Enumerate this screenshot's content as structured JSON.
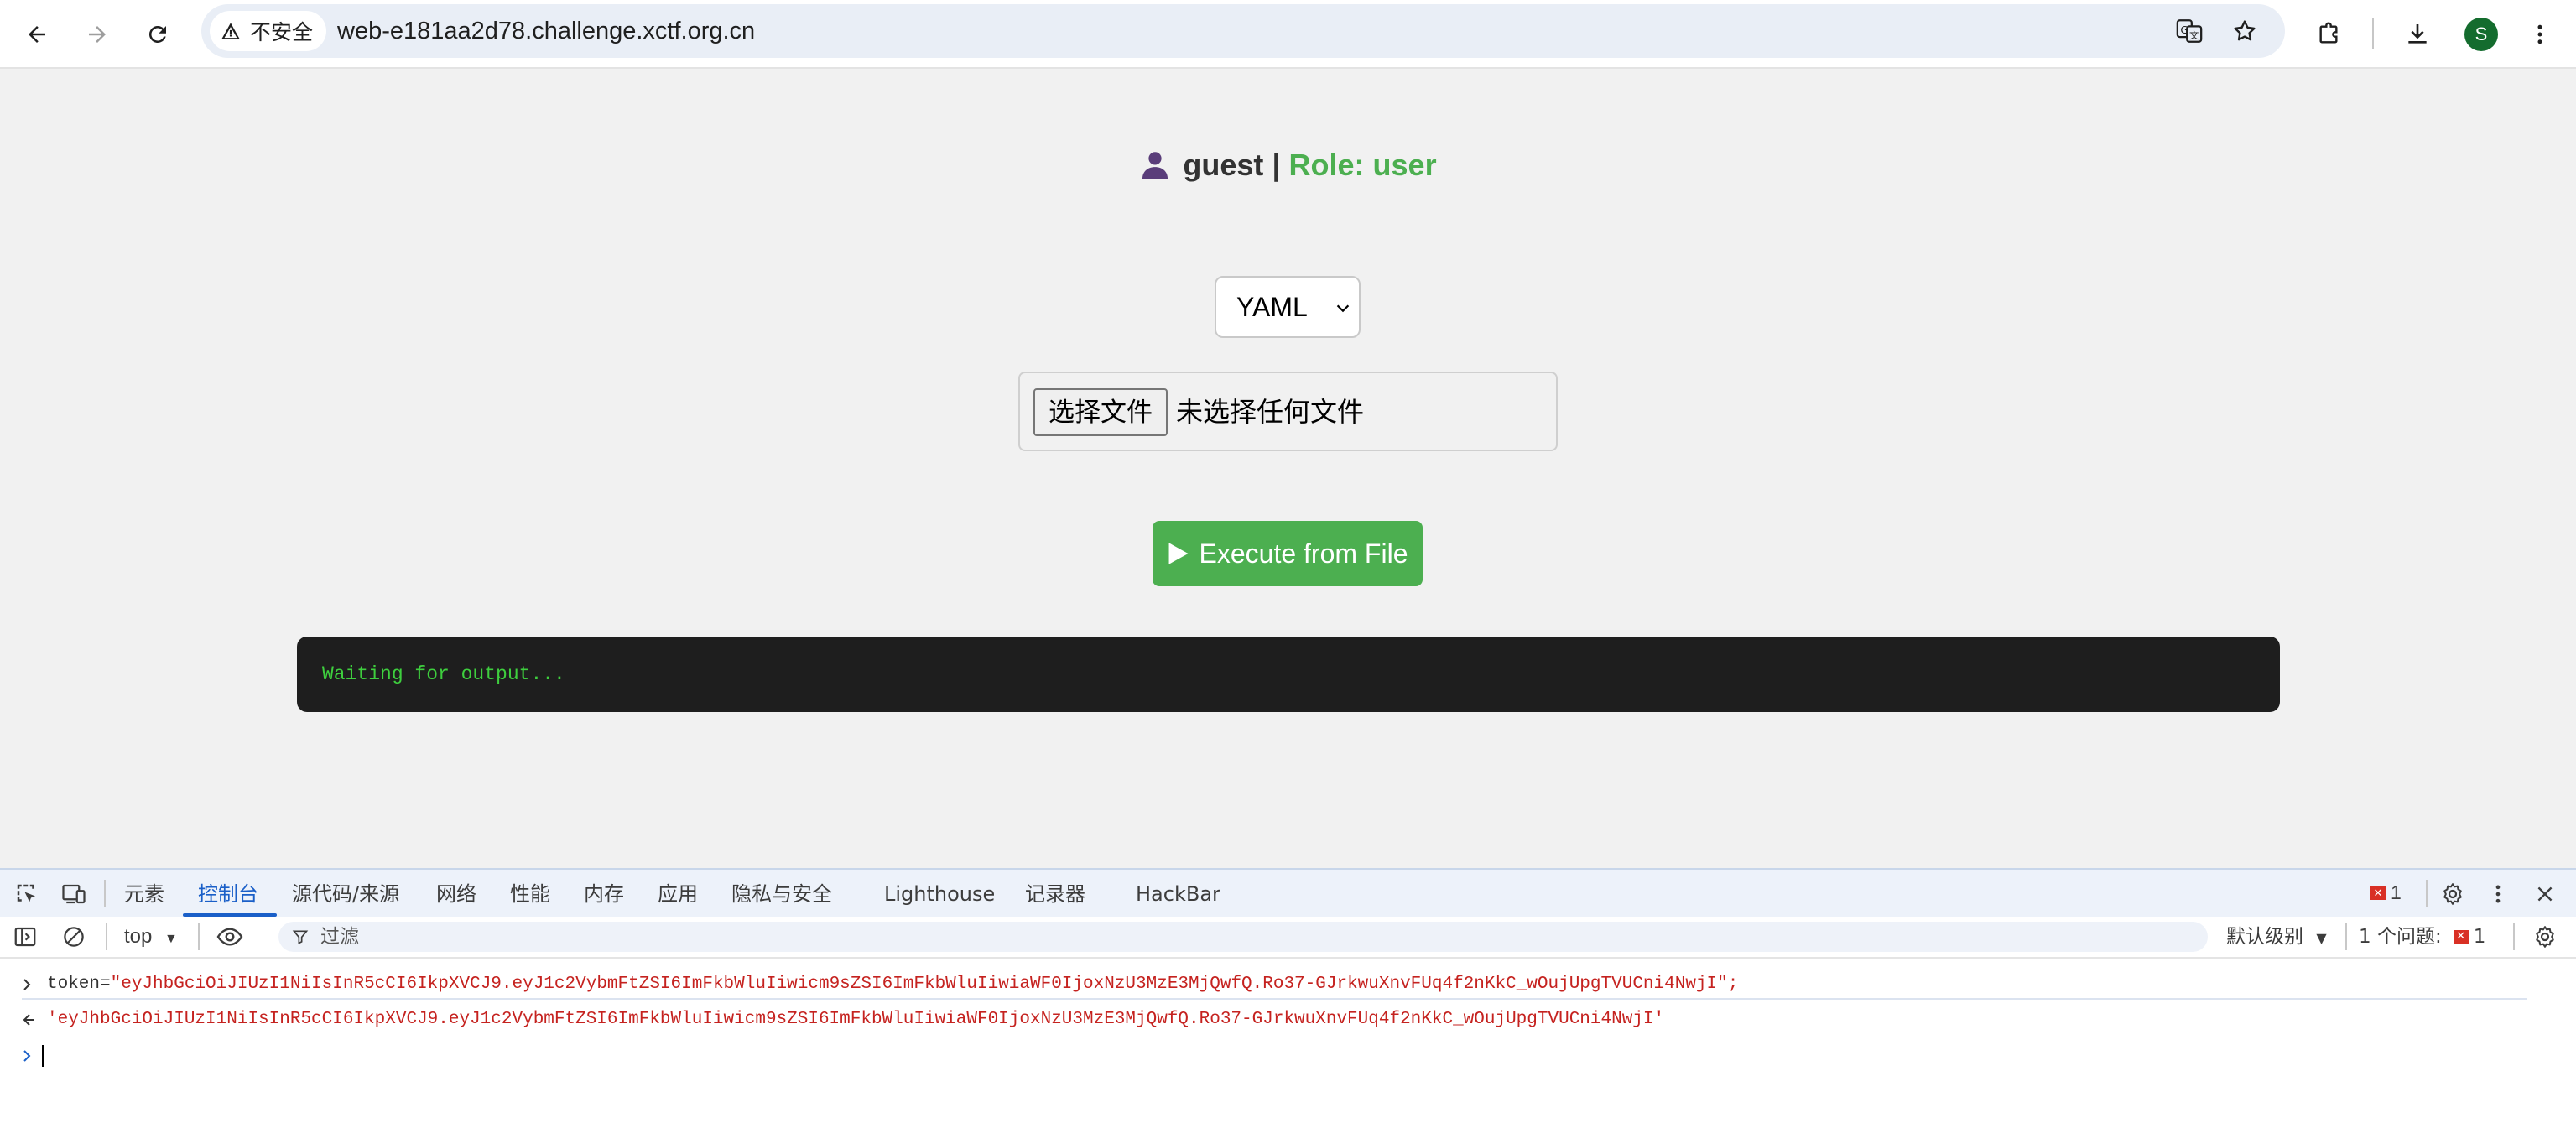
{
  "browser": {
    "security_label": "不安全",
    "url": "web-e181aa2d78.challenge.xctf.org.cn",
    "profile_initial": "S"
  },
  "page": {
    "username": "guest",
    "separator": "|",
    "role_text": "Role: user",
    "format_select": {
      "selected": "YAML"
    },
    "file_input": {
      "button_label": "选择文件",
      "status": "未选择任何文件"
    },
    "execute_button": "Execute from File",
    "output_text": "Waiting for output..."
  },
  "devtools": {
    "tabs": [
      "元素",
      "控制台",
      "源代码/来源",
      "网络",
      "性能",
      "内存",
      "应用",
      "隐私与安全",
      "Lighthouse",
      "记录器",
      "HackBar"
    ],
    "active_tab": "控制台",
    "error_count": "1",
    "context": "top",
    "filter_placeholder": "过滤",
    "log_level": "默认级别",
    "issues_label": "1 个问题:",
    "issues_count": "1",
    "console": {
      "input_prefix": "token=",
      "input_value": "\"eyJhbGciOiJIUzI1NiIsInR5cCI6IkpXVCJ9.eyJ1c2VybmFtZSI6ImFkbWluIiwicm9sZSI6ImFkbWluIiwiaWF0IjoxNzU3MzE3MjQwfQ.Ro37-GJrkwuXnvFUq4f2nKkC_wOujUpgTVUCni4NwjI\";",
      "output_value": "'eyJhbGciOiJIUzI1NiIsInR5cCI6IkpXVCJ9.eyJ1c2VybmFtZSI6ImFkbWluIiwicm9sZSI6ImFkbWluIiwiaWF0IjoxNzU3MzE3MjQwfQ.Ro37-GJrkwuXnvFUq4f2nKkC_wOujUpgTVUCni4NwjI'"
    }
  },
  "colors": {
    "role_green": "#4caf50",
    "button_green": "#4caf50",
    "output_bg": "#1e1e1e",
    "output_text": "#3ecf3e",
    "devtools_accent": "#1a5fc8",
    "error_red": "#c5221f"
  }
}
